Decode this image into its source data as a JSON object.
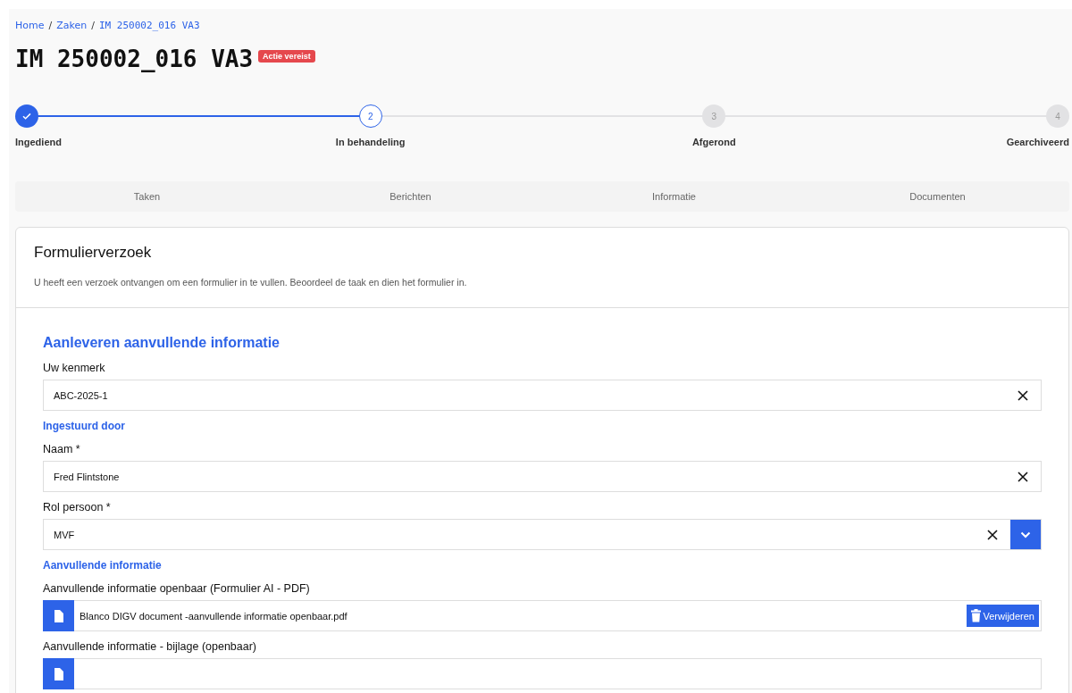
{
  "breadcrumb": [
    "Home",
    "Zaken",
    "IM 250002_016 VA3"
  ],
  "breadcrumb_separators": [
    "/",
    "/"
  ],
  "title": "IM 250002_016 VA3",
  "badge": "Actie vereist",
  "steps": [
    {
      "kind": "done",
      "label": "Ingediend"
    },
    {
      "kind": "current",
      "number": "2",
      "label": "In behandeling"
    },
    {
      "kind": "pending",
      "number": "3",
      "label": "Afgerond"
    },
    {
      "kind": "pending",
      "number": "4",
      "label": "Gearchiveerd"
    }
  ],
  "tabs": [
    {
      "label": "Taken",
      "selected": false
    },
    {
      "label": "Berichten",
      "selected": false
    },
    {
      "label": "Informatie",
      "selected": false
    },
    {
      "label": "Documenten",
      "selected": false
    }
  ],
  "card": {
    "title": "Formulierverzoek",
    "description": "U heeft een verzoek ontvangen om een formulier in te vullen. Beoordeel de taak en dien het formulier in.",
    "items": [
      {
        "kind": "heading",
        "text": "Aanleveren aanvullende informatie"
      },
      {
        "kind": "text",
        "label": "Uw kenmerk",
        "value": "ABC-2025-1"
      },
      {
        "kind": "subheading",
        "text": "Ingestuurd door"
      },
      {
        "kind": "text",
        "label": "Naam *",
        "value": "Fred Flintstone"
      },
      {
        "kind": "select",
        "label": "Rol persoon *",
        "value": "MVF"
      },
      {
        "kind": "subheading",
        "text": "Aanvullende informatie"
      },
      {
        "kind": "file",
        "label": "Aanvullende informatie openbaar (Formulier AI - PDF)",
        "file_name": "Blanco DIGV document -aanvullende informatie openbaar.pdf",
        "action": "Verwijderen"
      },
      {
        "kind": "file",
        "label": "Aanvullende informatie - bijlage (openbaar)"
      }
    ]
  }
}
